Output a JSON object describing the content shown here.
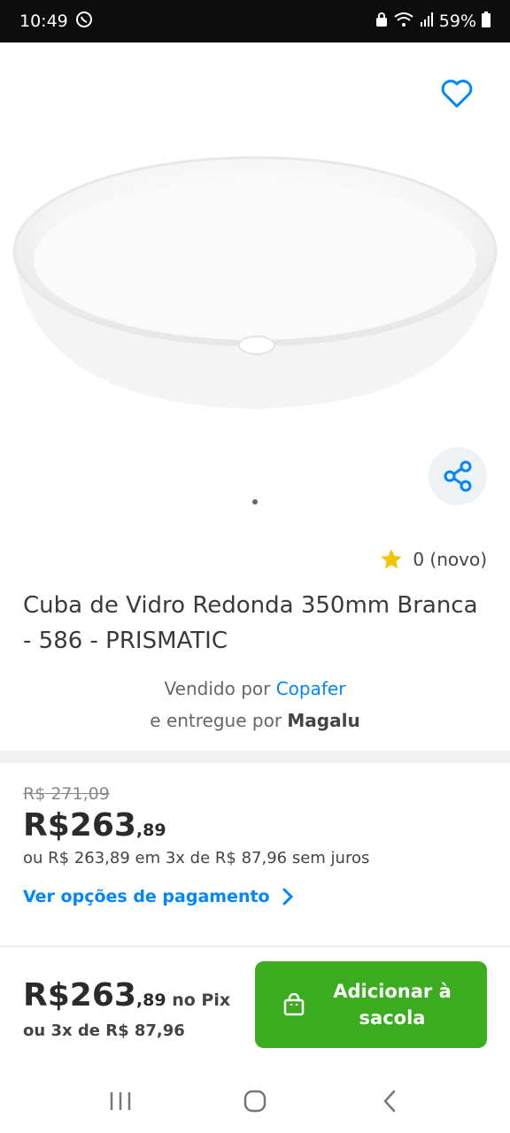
{
  "status": {
    "time": "10:49",
    "battery": "59%"
  },
  "product": {
    "rating": "0 (novo)",
    "title": "Cuba de Vidro Redonda 350mm Branca - 586 - PRISMATIC",
    "sold_by_prefix": "Vendido por ",
    "seller": "Copafer",
    "delivered_by_prefix": "e entregue por ",
    "deliverer": "Magalu"
  },
  "pricing": {
    "old_price": "R$ 271,09",
    "price_main": "R$263",
    "price_cents": ",89",
    "installments": "ou R$ 263,89 em 3x de R$ 87,96 sem juros",
    "payment_link": "Ver opções de pagamento"
  },
  "bottom": {
    "price_main": "R$263",
    "price_cents": ",89",
    "pix_label": " no Pix",
    "installments": "ou 3x de R$ 87,96",
    "add_button": "Adicionar à sacola"
  },
  "colors": {
    "accent_blue": "#0086ff",
    "button_green": "#3aac1d",
    "star_yellow": "#f5c400"
  }
}
